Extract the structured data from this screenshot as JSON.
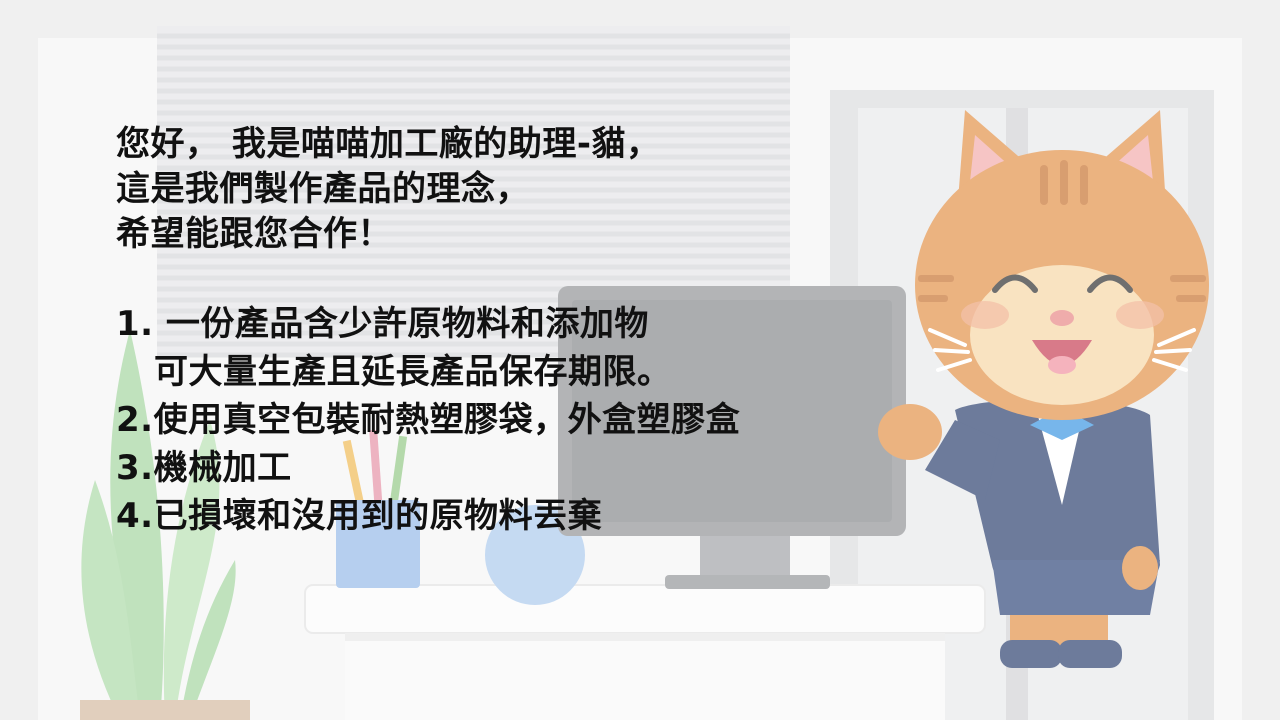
{
  "intro_lines": [
    "您好， 我是喵喵加工廠的助理-貓，",
    "這是我們製作產品的理念，",
    "希望能跟您合作！"
  ],
  "list_lines": [
    "1. 一份產品含少許原物料和添加物",
    "可大量生產且延長產品保存期限。",
    "2.使用真空包裝耐熱塑膠袋，外盒塑膠盒",
    "3.機械加工",
    "4.已損壞和沒用到的原物料丟棄"
  ],
  "colors": {
    "background": "#e9e9ea",
    "text": "#111111",
    "cat_fur": "#e08a3c",
    "suit": "#1f3566",
    "tie": "#2f8fe0"
  },
  "icons": [
    "cat-mascot",
    "potted-plant",
    "pencil-cup",
    "computer-monitor",
    "office-desk",
    "window-blinds",
    "door"
  ]
}
